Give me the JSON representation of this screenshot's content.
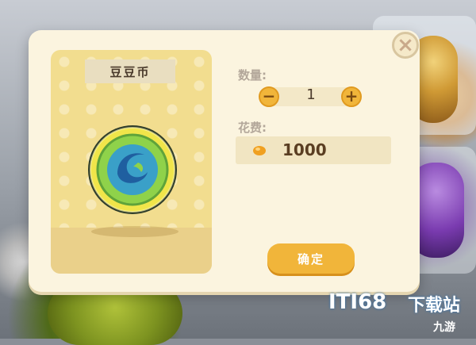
{
  "item": {
    "name": "豆豆币"
  },
  "quantity": {
    "label": "数量:",
    "value": "1",
    "decrease_symbol": "−",
    "increase_symbol": "+"
  },
  "cost": {
    "label": "花费:",
    "value": "1000",
    "currency_icon": "bean-icon"
  },
  "actions": {
    "confirm_label": "确定",
    "close_symbol": "×"
  },
  "watermark": {
    "brand": "ITI68",
    "suffix": "下载站",
    "corner": "九游"
  },
  "colors": {
    "accent": "#f1b53a",
    "dialog_bg": "#fbf4df",
    "panel_bg": "#f2dd8f"
  }
}
